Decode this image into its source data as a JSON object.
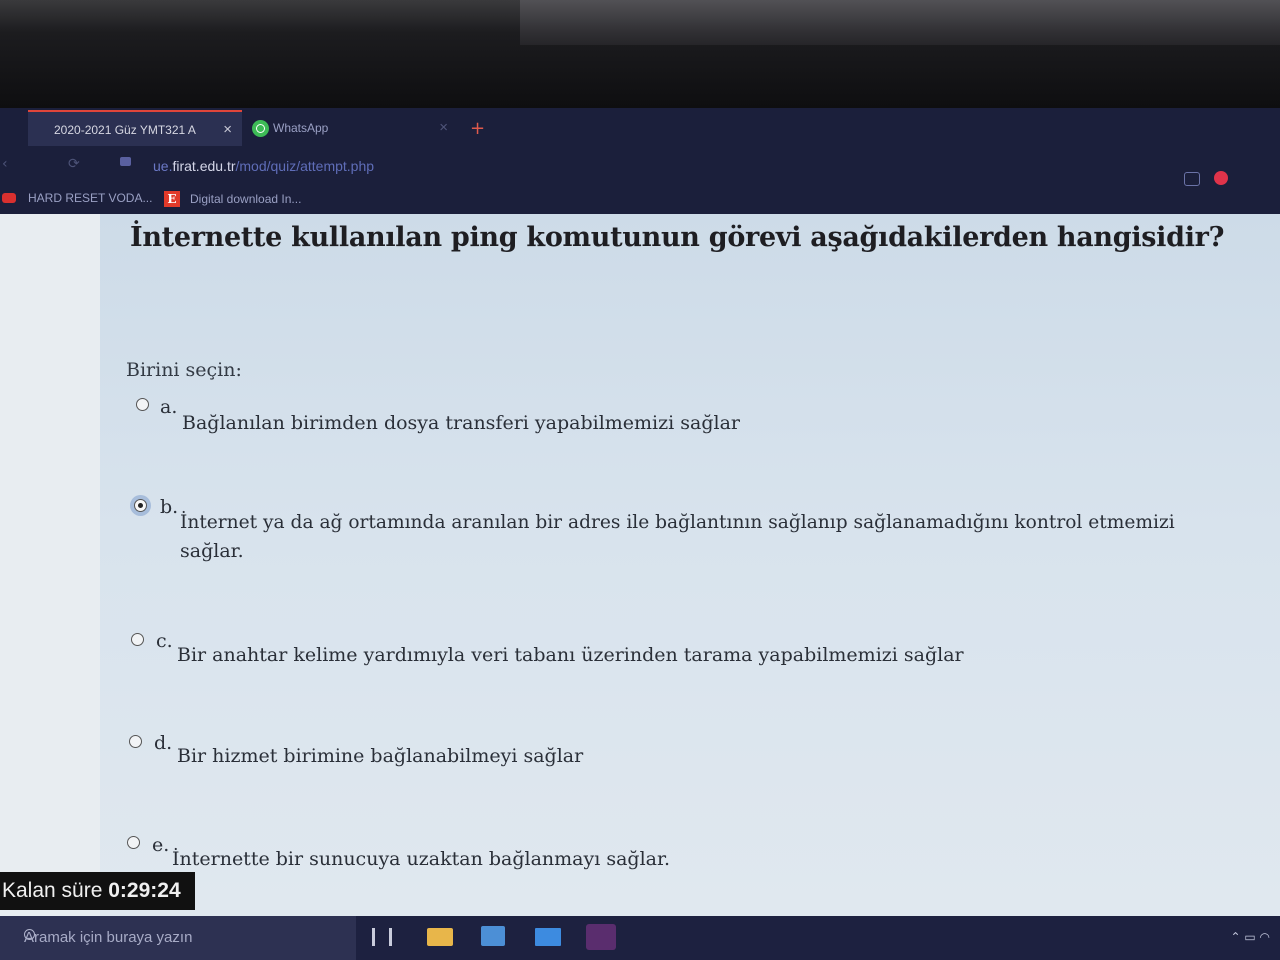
{
  "browser": {
    "tabs": [
      {
        "title": "2020-2021 Güz YMT321 A",
        "close_icon": "×",
        "active": true
      },
      {
        "title": "WhatsApp",
        "close_icon": "×",
        "active": false
      }
    ],
    "new_tab_icon": "+",
    "url": {
      "subdomain": "ue.",
      "host": "firat.edu.tr",
      "path": "/mod/quiz/attempt.php"
    },
    "bookmarks": [
      {
        "label": "HARD RESET VODA..."
      },
      {
        "label": "Digital download In...",
        "icon_letter": "E"
      }
    ]
  },
  "quiz": {
    "question": "İnternette kullanılan ping komutunun görevi aşağıdakilerden hangisidir?",
    "prompt": "Birini seçin:",
    "options": [
      {
        "letter": "a.",
        "text": "Bağlanılan birimden dosya transferi yapabilmemizi sağlar",
        "selected": false
      },
      {
        "letter": "b.",
        "text": "İnternet ya da ağ ortamında aranılan bir adres ile bağlantının sağlanıp sağlanamadığını kontrol etmemizi",
        "text_line2": "sağlar.",
        "selected": true
      },
      {
        "letter": "c.",
        "text": "Bir anahtar kelime yardımıyla veri tabanı üzerinden tarama yapabilmemizi sağlar",
        "selected": false
      },
      {
        "letter": "d.",
        "text": "Bir hizmet birimine bağlanabilmeyi sağlar",
        "selected": false
      },
      {
        "letter": "e.",
        "text": "İnternette bir sunucuya uzaktan bağlanmayı sağlar.",
        "selected": false
      }
    ],
    "timer": {
      "label": "Kalan süre",
      "value": "0:29:24"
    }
  },
  "taskbar": {
    "search_placeholder": "Aramak için buraya yazın",
    "icons": [
      "task-view-icon",
      "file-explorer-icon",
      "store-icon",
      "mail-icon",
      "app-icon"
    ]
  },
  "colors": {
    "accent": "#e0453a",
    "selected_radio": "#a7bddb"
  }
}
